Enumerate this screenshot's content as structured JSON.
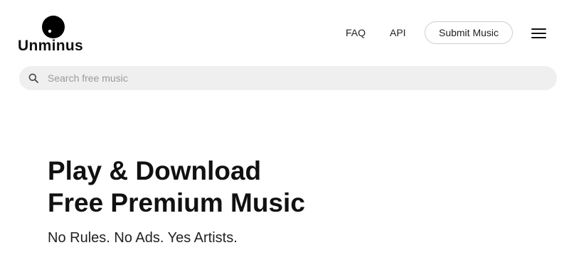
{
  "header": {
    "logo_text": "Unminus",
    "nav": {
      "faq": "FAQ",
      "api": "API"
    },
    "submit_label": "Submit Music",
    "menu_icon": "hamburger-menu-icon"
  },
  "search": {
    "placeholder": "Search free music",
    "value": "",
    "icon": "search-icon"
  },
  "hero": {
    "title_line1": "Play & Download",
    "title_line2": "Free Premium Music",
    "subtitle": "No Rules. No Ads. Yes Artists."
  }
}
